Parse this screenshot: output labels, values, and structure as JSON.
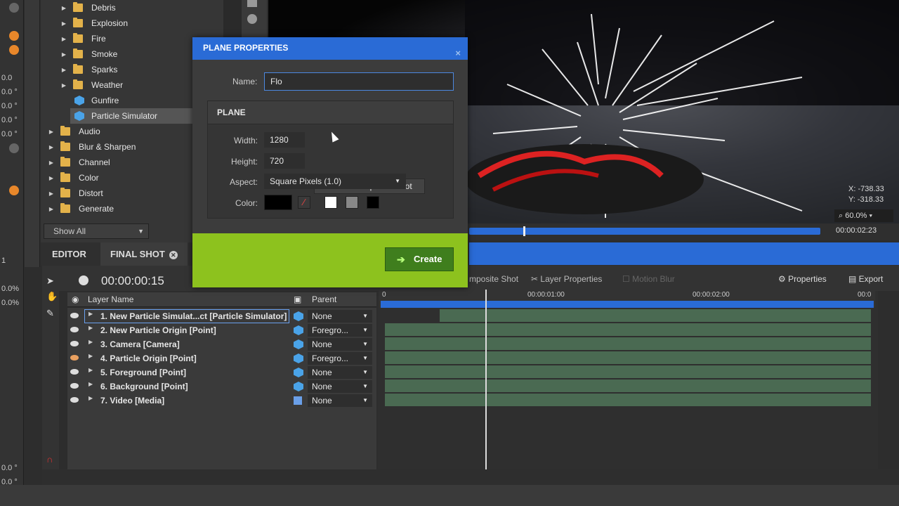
{
  "colors": {
    "accent": "#2a6bd6",
    "create_green": "#8dc21e",
    "folder": "#e3b24a"
  },
  "tree": {
    "items": [
      {
        "label": "Debris",
        "type": "folder"
      },
      {
        "label": "Explosion",
        "type": "folder"
      },
      {
        "label": "Fire",
        "type": "folder"
      },
      {
        "label": "Smoke",
        "type": "folder"
      },
      {
        "label": "Sparks",
        "type": "folder"
      },
      {
        "label": "Weather",
        "type": "folder"
      },
      {
        "label": "Gunfire",
        "type": "effect"
      },
      {
        "label": "Particle Simulator",
        "type": "effect"
      },
      {
        "label": "Audio",
        "type": "folder"
      },
      {
        "label": "Blur & Sharpen",
        "type": "folder"
      },
      {
        "label": "Channel",
        "type": "folder"
      },
      {
        "label": "Color",
        "type": "folder"
      },
      {
        "label": "Distort",
        "type": "folder"
      },
      {
        "label": "Generate",
        "type": "folder"
      }
    ],
    "filter": "Show All"
  },
  "leftstrip": {
    "values": [
      "0.0",
      "0.0 °",
      "0.0 °",
      "0.0 °",
      "0.0 °",
      "1",
      "0.0%",
      "0.0%",
      "0.0 °",
      "0.0 °"
    ]
  },
  "viewer": {
    "time": "00:00:02:23",
    "x": "X:   -738.33",
    "y": "Y:   -318.33",
    "zoom": "60.0%"
  },
  "tabs": {
    "editor": "EDITOR",
    "final_shot": "FINAL SHOT"
  },
  "timeline": {
    "timecode": "00:00:00:15",
    "toolbar": {
      "composite": "mposite Shot",
      "layer_props": "Layer Properties",
      "motion_blur": "Motion Blur",
      "properties": "Properties",
      "export": "Export"
    },
    "headers": {
      "layer_name": "Layer Name",
      "parent": "Parent"
    },
    "ruler": [
      "0",
      "00:00:01:00",
      "00:00:02:00",
      "00:0"
    ],
    "layers": [
      {
        "name": "1. New Particle Simulat...ct [Particle Simulator]",
        "parent": "None"
      },
      {
        "name": "2. New Particle Origin [Point]",
        "parent": "Foregro..."
      },
      {
        "name": "3. Camera [Camera]",
        "parent": "None"
      },
      {
        "name": "4. Particle Origin [Point]",
        "parent": "Foregro..."
      },
      {
        "name": "5. Foreground [Point]",
        "parent": "None"
      },
      {
        "name": "6. Background [Point]",
        "parent": "None"
      },
      {
        "name": "7. Video [Media]",
        "parent": "None"
      }
    ]
  },
  "dialog": {
    "title": "PLANE PROPERTIES",
    "close": "×",
    "name_label": "Name:",
    "name_value": "Flo",
    "section": "PLANE",
    "width_label": "Width:",
    "width_value": "1280",
    "height_label": "Height:",
    "height_value": "720",
    "match_button": "Match Composite Shot",
    "aspect_label": "Aspect:",
    "aspect_value": "Square Pixels (1.0)",
    "color_label": "Color:",
    "create_button": "Create"
  }
}
